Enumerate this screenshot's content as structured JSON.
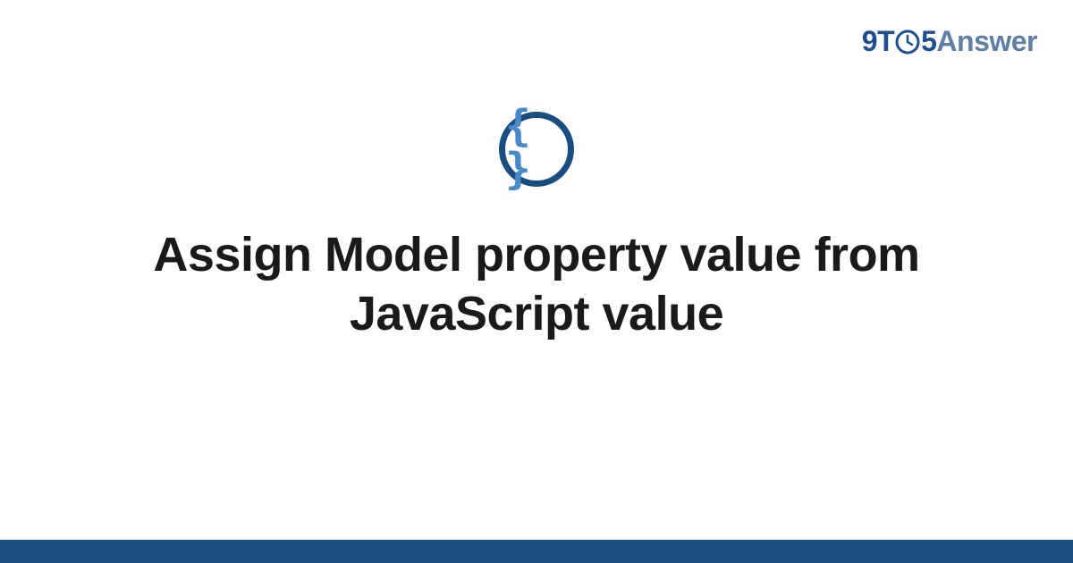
{
  "brand": {
    "prefix": "9T",
    "suffix": "5",
    "word": "Answer"
  },
  "category": {
    "icon_glyph": "{ }",
    "icon_name": "curly-braces-icon"
  },
  "title": "Assign Model property value from JavaScript value",
  "colors": {
    "brand_dark": "#1f4f8f",
    "brand_light": "#5f7fa5",
    "ring": "#1a4d80",
    "icon_inner": "#4a89c8",
    "bar": "#1a4d80"
  }
}
